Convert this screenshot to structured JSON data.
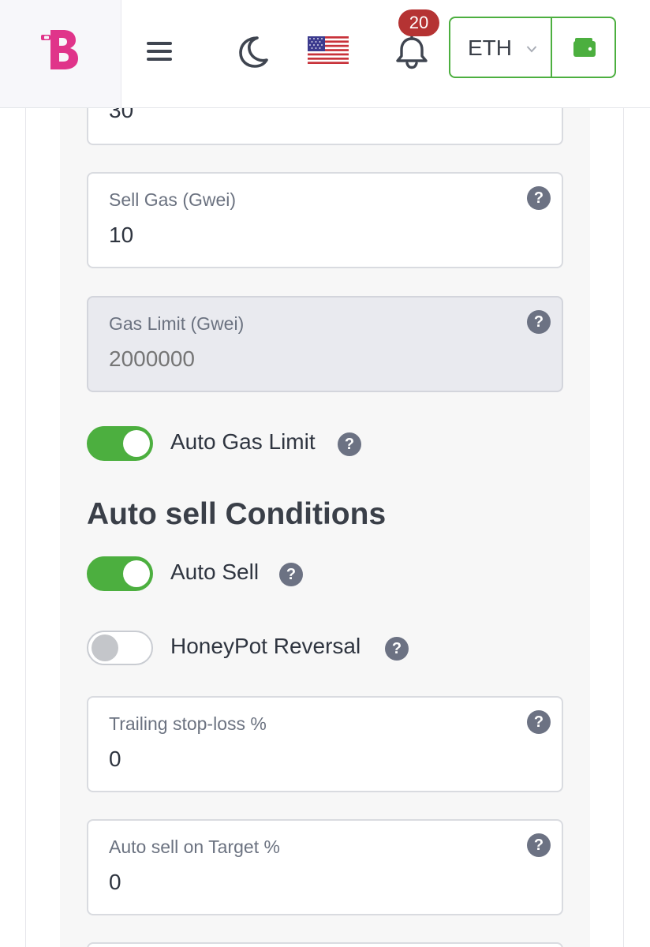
{
  "header": {
    "notification_count": "20",
    "network": {
      "selected": "ETH"
    },
    "colors": {
      "accent_green": "#4caf3f",
      "brand_pink": "#e0348a",
      "badge_red": "#b53333"
    },
    "icons": [
      "logo-b",
      "menu-icon",
      "moon-icon",
      "us-flag-icon",
      "bell-icon",
      "chevron-down-icon",
      "wallet-icon"
    ]
  },
  "form": {
    "buy_gas_value": "30",
    "sell_gas": {
      "label": "Sell Gas (Gwei)",
      "value": "10"
    },
    "gas_limit": {
      "label": "Gas Limit (Gwei)",
      "placeholder": "2000000",
      "disabled": true
    },
    "auto_gas_limit": {
      "label": "Auto Gas Limit",
      "enabled": true
    },
    "auto_sell_section_title": "Auto sell Conditions",
    "auto_sell": {
      "label": "Auto Sell",
      "enabled": true
    },
    "honeypot_reversal": {
      "label": "HoneyPot Reversal",
      "enabled": false
    },
    "trailing_stop_loss": {
      "label": "Trailing stop-loss %",
      "value": "0"
    },
    "auto_sell_target": {
      "label": "Auto sell on Target %",
      "value": "0"
    },
    "help_glyph": "?"
  }
}
